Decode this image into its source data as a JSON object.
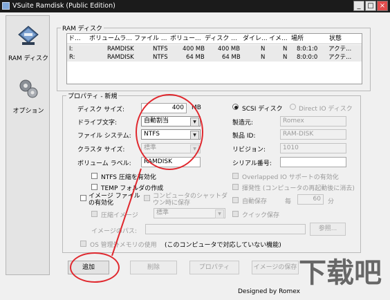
{
  "window": {
    "title": "VSuite Ramdisk (Public Edition)",
    "controls": {
      "minimize": "_",
      "maximize": "□",
      "close": "×"
    }
  },
  "sidebar": {
    "items": [
      {
        "label": "RAM ディスク",
        "icon": "ram-disk-icon"
      },
      {
        "label": "オプション",
        "icon": "gears-icon"
      }
    ]
  },
  "ram_disk_group": {
    "label": "RAM ディスク",
    "columns": [
      "ド...",
      "ボリュームラ...",
      "ファイル ...",
      "ボリュー...",
      "ディスク ...",
      "ダイレ...",
      "イメ...",
      "場所",
      "状態"
    ],
    "rows": [
      [
        "I:",
        "RAMDISK",
        "NTFS",
        "400 MB",
        "400 MB",
        "N",
        "N",
        "8:0:1:0",
        "アクテ..."
      ],
      [
        "R:",
        "RAMDISK",
        "NTFS",
        "64 MB",
        "64 MB",
        "N",
        "N",
        "8:0:0:0",
        "アクテ..."
      ]
    ]
  },
  "props_group": {
    "label": "プロパティ - 新規",
    "disk_size_label": "ディスク サイズ:",
    "disk_size_value": "400",
    "disk_size_unit": "MB",
    "drive_letter_label": "ドライブ文字:",
    "drive_letter_value": "自動割当",
    "filesystem_label": "ファイル システム:",
    "filesystem_value": "NTFS",
    "cluster_label": "クラスタ サイズ:",
    "cluster_value": "標準",
    "volume_label_label": "ボリューム ラベル:",
    "volume_label_value": "RAMDISK",
    "scsi_label": "SCSI ディスク",
    "direct_io_label": "Direct IO ディスク",
    "maker_label": "製造元:",
    "maker_value": "Romex",
    "product_label": "製品 ID:",
    "product_value": "RAM-DISK",
    "revision_label": "リビジョン:",
    "revision_value": "1010",
    "serial_label": "シリアル番号:",
    "serial_value": "",
    "ntfs_compress": "NTFS 圧縮を有効化",
    "temp_folder": "TEMP フォルダの作成",
    "overlapped_io": "Overlapped IO サポートの有効化",
    "volatile": "揮発性 (コンピュータの再起動後に消去)",
    "image_file_enable": "イメージ ファイルの有効化",
    "save_on_shutdown": "コンピュータのシャットダウン時に保存",
    "auto_save": "自動保存",
    "auto_save_every": "毎",
    "auto_save_value": "60",
    "auto_save_unit": "分",
    "compress_image": "圧縮イメージ",
    "compress_value": "標準",
    "quick_save": "クイック保存",
    "image_path_label": "イメージのパス:",
    "image_path_value": "",
    "browse_button": "参照...",
    "os_memory": "OS 管理外メモリの使用",
    "os_memory_note": "(このコンピュータで対応していない機能)"
  },
  "buttons": {
    "add": "追加",
    "delete": "削除",
    "properties": "プロパティ",
    "save_image": "イメージの保存"
  },
  "footer": "Designed by Romex",
  "watermark": "下载吧",
  "colors": {
    "annotation": "#e0282e",
    "titlebar": "#1b1b1b"
  }
}
